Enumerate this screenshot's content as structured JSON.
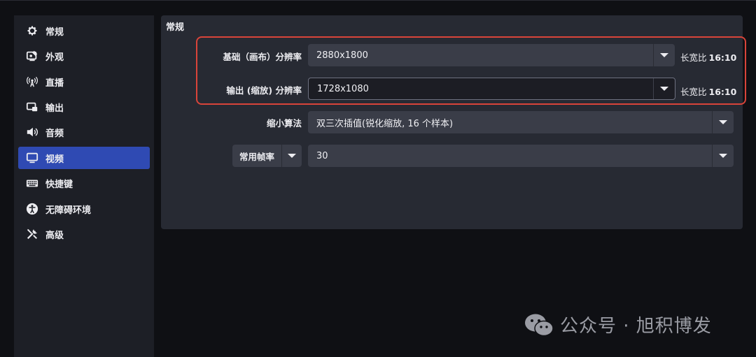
{
  "sidebar": {
    "items": [
      {
        "label": "常规",
        "icon": "gear-icon"
      },
      {
        "label": "外观",
        "icon": "appearance-icon"
      },
      {
        "label": "直播",
        "icon": "broadcast-icon"
      },
      {
        "label": "输出",
        "icon": "output-icon"
      },
      {
        "label": "音频",
        "icon": "speaker-icon"
      },
      {
        "label": "视频",
        "icon": "monitor-icon",
        "active": true
      },
      {
        "label": "快捷键",
        "icon": "keyboard-icon"
      },
      {
        "label": "无障碍环境",
        "icon": "accessibility-icon"
      },
      {
        "label": "高级",
        "icon": "tools-icon"
      }
    ]
  },
  "main": {
    "section_title": "常规",
    "base_resolution": {
      "label": "基础（画布）分辨率",
      "value": "2880x1800",
      "aspect_label": "长宽比",
      "aspect_value": "16:10"
    },
    "output_resolution": {
      "label": "输出 (缩放) 分辨率",
      "value": "1728x1080",
      "aspect_label": "长宽比",
      "aspect_value": "16:10"
    },
    "downscale_filter": {
      "label": "缩小算法",
      "value": "双三次插值(锐化缩放, 16 个样本)"
    },
    "fps": {
      "type_value": "常用帧率",
      "value": "30"
    }
  },
  "watermark": {
    "text": "公众号 · 旭积博发",
    "icon": "wechat-icon"
  },
  "colors": {
    "active": "#2f4ab3",
    "highlight": "#d9443a",
    "panel": "#272a33",
    "sidebar": "#1d1f26"
  }
}
